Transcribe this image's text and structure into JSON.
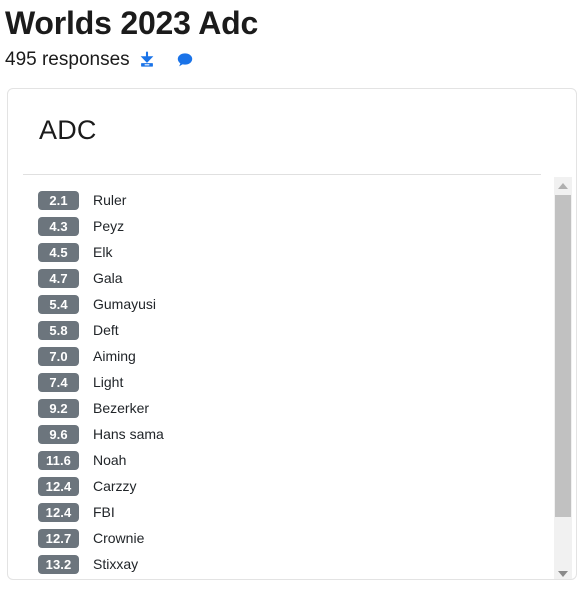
{
  "header": {
    "title": "Worlds 2023 Adc",
    "responses_label": "495 responses",
    "download_icon": "download-icon",
    "comment_icon": "comment-icon",
    "icon_color": "#1a73e8"
  },
  "card": {
    "title": "ADC",
    "badge_color": "#6c757d",
    "badge_text_color": "#ffffff",
    "rankings": [
      {
        "score": "2.1",
        "name": "Ruler"
      },
      {
        "score": "4.3",
        "name": "Peyz"
      },
      {
        "score": "4.5",
        "name": "Elk"
      },
      {
        "score": "4.7",
        "name": "Gala"
      },
      {
        "score": "5.4",
        "name": "Gumayusi"
      },
      {
        "score": "5.8",
        "name": "Deft"
      },
      {
        "score": "7.0",
        "name": "Aiming"
      },
      {
        "score": "7.4",
        "name": "Light"
      },
      {
        "score": "9.2",
        "name": "Bezerker"
      },
      {
        "score": "9.6",
        "name": "Hans sama"
      },
      {
        "score": "11.6",
        "name": "Noah"
      },
      {
        "score": "12.4",
        "name": "Carzzy"
      },
      {
        "score": "12.4",
        "name": "FBI"
      },
      {
        "score": "12.7",
        "name": "Crownie"
      },
      {
        "score": "13.2",
        "name": "Stixxay"
      }
    ]
  },
  "scrollbar": {
    "up_icon": "chevron-up-icon",
    "down_icon": "chevron-down-icon"
  }
}
